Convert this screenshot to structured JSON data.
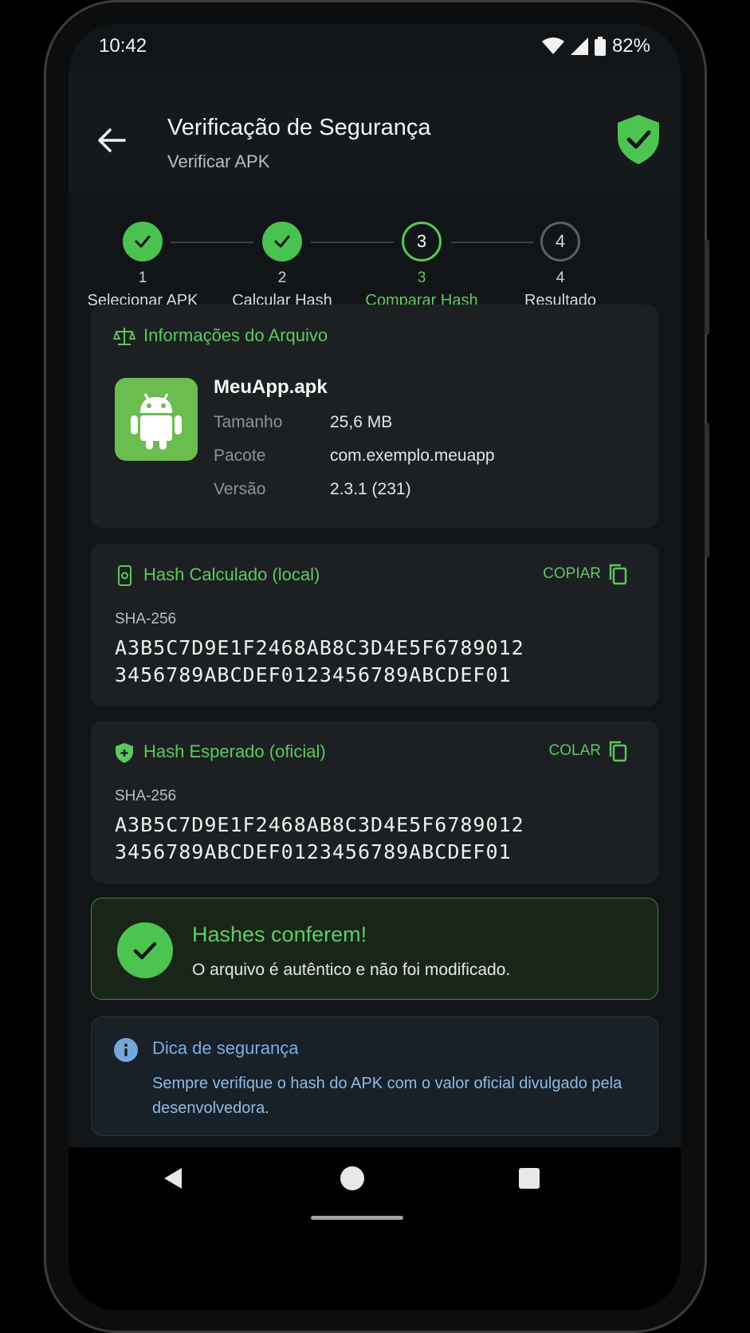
{
  "status": {
    "time": "10:42",
    "battery": "82%",
    "icons": [
      "wifi-icon",
      "signal-icon",
      "battery-icon"
    ]
  },
  "appbar": {
    "title": "Verificação de Segurança",
    "subtitle": "Verificar APK",
    "back_icon": "arrow-left-icon",
    "badge_icon": "shield-check-icon"
  },
  "stepper": {
    "steps": [
      {
        "number": "1",
        "label": "Selecionar APK",
        "state": "done"
      },
      {
        "number": "2",
        "label": "Calcular Hash",
        "state": "done"
      },
      {
        "number": "3",
        "label": "Comparar Hash",
        "state": "active"
      },
      {
        "number": "4",
        "label": "Resultado",
        "state": "pending"
      }
    ]
  },
  "file_info": {
    "title": "Informações do Arquivo",
    "name": "MeuApp.apk",
    "rows": [
      {
        "key": "Tamanho",
        "value": "25,6 MB"
      },
      {
        "key": "Pacote",
        "value": "com.exemplo.meuapp"
      },
      {
        "key": "Versão",
        "value": "2.3.1 (231)"
      }
    ]
  },
  "hash_local": {
    "title": "Hash Calculado (local)",
    "action": "COPIAR",
    "algorithm": "SHA-256",
    "line1": "A3B5C7D9E1F2468AB8C3D4E5F6789012",
    "line2": "3456789ABCDEF0123456789ABCDEF01"
  },
  "hash_expected": {
    "title": "Hash Esperado (oficial)",
    "action": "COLAR",
    "algorithm": "SHA-256",
    "line1": "A3B5C7D9E1F2468AB8C3D4E5F6789012",
    "line2": "3456789ABCDEF0123456789ABCDEF01"
  },
  "result": {
    "title": "Hashes conferem!",
    "text": "O arquivo é autêntico e não foi modificado."
  },
  "tip": {
    "title": "Dica de segurança",
    "text": "Sempre verifique o hash do APK com o valor oficial divulgado pela desenvolvedora."
  },
  "colors": {
    "accent": "#4dc451",
    "background": "#121517",
    "card": "#1d2022",
    "info": "#7ab0e5"
  }
}
